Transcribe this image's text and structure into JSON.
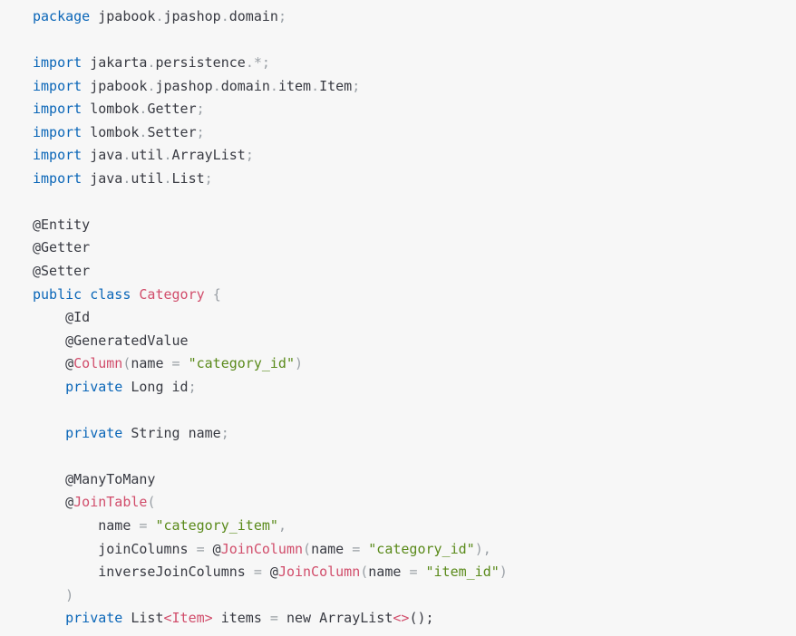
{
  "code": {
    "lines": [
      [
        {
          "t": "kw",
          "v": "package"
        },
        {
          "t": "tx",
          "v": " jpabook"
        },
        {
          "t": "pn",
          "v": "."
        },
        {
          "t": "tx",
          "v": "jpashop"
        },
        {
          "t": "pn",
          "v": "."
        },
        {
          "t": "tx",
          "v": "domain"
        },
        {
          "t": "pn",
          "v": ";"
        }
      ],
      [],
      [
        {
          "t": "kw",
          "v": "import"
        },
        {
          "t": "tx",
          "v": " jakarta"
        },
        {
          "t": "pn",
          "v": "."
        },
        {
          "t": "tx",
          "v": "persistence"
        },
        {
          "t": "pn",
          "v": ".*;"
        }
      ],
      [
        {
          "t": "kw",
          "v": "import"
        },
        {
          "t": "tx",
          "v": " jpabook"
        },
        {
          "t": "pn",
          "v": "."
        },
        {
          "t": "tx",
          "v": "jpashop"
        },
        {
          "t": "pn",
          "v": "."
        },
        {
          "t": "tx",
          "v": "domain"
        },
        {
          "t": "pn",
          "v": "."
        },
        {
          "t": "tx",
          "v": "item"
        },
        {
          "t": "pn",
          "v": "."
        },
        {
          "t": "tx",
          "v": "Item"
        },
        {
          "t": "pn",
          "v": ";"
        }
      ],
      [
        {
          "t": "kw",
          "v": "import"
        },
        {
          "t": "tx",
          "v": " lombok"
        },
        {
          "t": "pn",
          "v": "."
        },
        {
          "t": "tx",
          "v": "Getter"
        },
        {
          "t": "pn",
          "v": ";"
        }
      ],
      [
        {
          "t": "kw",
          "v": "import"
        },
        {
          "t": "tx",
          "v": " lombok"
        },
        {
          "t": "pn",
          "v": "."
        },
        {
          "t": "tx",
          "v": "Setter"
        },
        {
          "t": "pn",
          "v": ";"
        }
      ],
      [
        {
          "t": "kw",
          "v": "import"
        },
        {
          "t": "tx",
          "v": " java"
        },
        {
          "t": "pn",
          "v": "."
        },
        {
          "t": "tx",
          "v": "util"
        },
        {
          "t": "pn",
          "v": "."
        },
        {
          "t": "tx",
          "v": "ArrayList"
        },
        {
          "t": "pn",
          "v": ";"
        }
      ],
      [
        {
          "t": "kw",
          "v": "import"
        },
        {
          "t": "tx",
          "v": " java"
        },
        {
          "t": "pn",
          "v": "."
        },
        {
          "t": "tx",
          "v": "util"
        },
        {
          "t": "pn",
          "v": "."
        },
        {
          "t": "tx",
          "v": "List"
        },
        {
          "t": "pn",
          "v": ";"
        }
      ],
      [],
      [
        {
          "t": "tx",
          "v": "@Entity"
        }
      ],
      [
        {
          "t": "tx",
          "v": "@Getter"
        }
      ],
      [
        {
          "t": "tx",
          "v": "@Setter"
        }
      ],
      [
        {
          "t": "kw",
          "v": "public"
        },
        {
          "t": "tx",
          "v": " "
        },
        {
          "t": "kw",
          "v": "class"
        },
        {
          "t": "tx",
          "v": " "
        },
        {
          "t": "cls",
          "v": "Category"
        },
        {
          "t": "tx",
          "v": " "
        },
        {
          "t": "pn",
          "v": "{"
        }
      ],
      [
        {
          "t": "tx",
          "v": "    @Id"
        }
      ],
      [
        {
          "t": "tx",
          "v": "    @GeneratedValue"
        }
      ],
      [
        {
          "t": "tx",
          "v": "    @"
        },
        {
          "t": "cls",
          "v": "Column"
        },
        {
          "t": "pn",
          "v": "("
        },
        {
          "t": "tx",
          "v": "name "
        },
        {
          "t": "pn",
          "v": "="
        },
        {
          "t": "tx",
          "v": " "
        },
        {
          "t": "str",
          "v": "\"category_id\""
        },
        {
          "t": "pn",
          "v": ")"
        }
      ],
      [
        {
          "t": "tx",
          "v": "    "
        },
        {
          "t": "kw",
          "v": "private"
        },
        {
          "t": "tx",
          "v": " Long id"
        },
        {
          "t": "pn",
          "v": ";"
        }
      ],
      [],
      [
        {
          "t": "tx",
          "v": "    "
        },
        {
          "t": "kw",
          "v": "private"
        },
        {
          "t": "tx",
          "v": " String name"
        },
        {
          "t": "pn",
          "v": ";"
        }
      ],
      [],
      [
        {
          "t": "tx",
          "v": "    @ManyToMany"
        }
      ],
      [
        {
          "t": "tx",
          "v": "    @"
        },
        {
          "t": "cls",
          "v": "JoinTable"
        },
        {
          "t": "pn",
          "v": "("
        }
      ],
      [
        {
          "t": "tx",
          "v": "        name "
        },
        {
          "t": "pn",
          "v": "="
        },
        {
          "t": "tx",
          "v": " "
        },
        {
          "t": "str",
          "v": "\"category_item\""
        },
        {
          "t": "pn",
          "v": ","
        }
      ],
      [
        {
          "t": "tx",
          "v": "        joinColumns "
        },
        {
          "t": "pn",
          "v": "="
        },
        {
          "t": "tx",
          "v": " @"
        },
        {
          "t": "cls",
          "v": "JoinColumn"
        },
        {
          "t": "pn",
          "v": "("
        },
        {
          "t": "tx",
          "v": "name "
        },
        {
          "t": "pn",
          "v": "="
        },
        {
          "t": "tx",
          "v": " "
        },
        {
          "t": "str",
          "v": "\"category_id\""
        },
        {
          "t": "pn",
          "v": "),"
        }
      ],
      [
        {
          "t": "tx",
          "v": "        inverseJoinColumns "
        },
        {
          "t": "pn",
          "v": "="
        },
        {
          "t": "tx",
          "v": " @"
        },
        {
          "t": "cls",
          "v": "JoinColumn"
        },
        {
          "t": "pn",
          "v": "("
        },
        {
          "t": "tx",
          "v": "name "
        },
        {
          "t": "pn",
          "v": "="
        },
        {
          "t": "tx",
          "v": " "
        },
        {
          "t": "str",
          "v": "\"item_id\""
        },
        {
          "t": "pn",
          "v": ")"
        }
      ],
      [
        {
          "t": "tx",
          "v": "    "
        },
        {
          "t": "pn",
          "v": ")"
        }
      ],
      [
        {
          "t": "tx",
          "v": "    "
        },
        {
          "t": "kw",
          "v": "private"
        },
        {
          "t": "tx",
          "v": " List"
        },
        {
          "t": "cls",
          "v": "<Item>"
        },
        {
          "t": "tx",
          "v": " items "
        },
        {
          "t": "pn",
          "v": "="
        },
        {
          "t": "tx",
          "v": " new ArrayList"
        },
        {
          "t": "cls",
          "v": "<>"
        },
        {
          "t": "tx",
          "v": "();"
        }
      ]
    ]
  },
  "colors": {
    "background": "#f7f7f7",
    "keyword": "#0a66b8",
    "class_name": "#d14d6b",
    "string": "#5a8a1a",
    "punctuation": "#9aa0a6",
    "text": "#383a42"
  }
}
